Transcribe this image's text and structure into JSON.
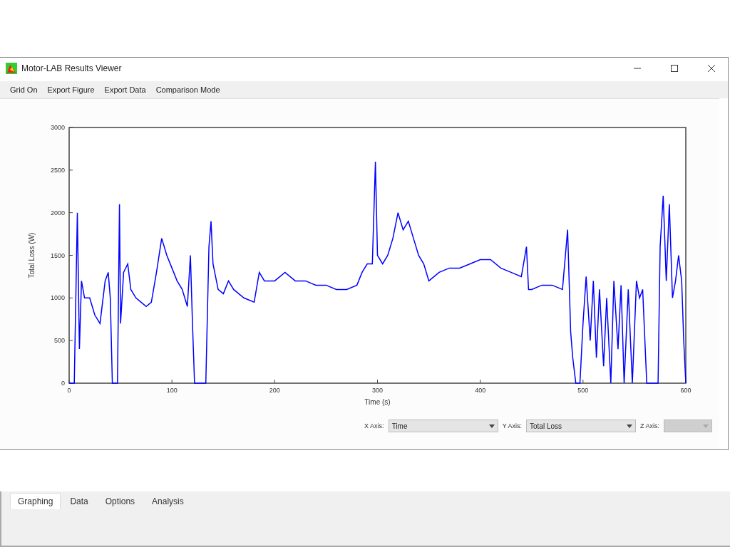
{
  "window": {
    "title": "Motor-LAB Results Viewer"
  },
  "menu": [
    "Grid On",
    "Export Figure",
    "Export Data",
    "Comparison Mode"
  ],
  "chart_data": {
    "type": "line",
    "xlabel": "Time (s)",
    "ylabel": "Total Loss (W)",
    "xlim": [
      0,
      600
    ],
    "ylim": [
      0,
      3000
    ],
    "xticks": [
      0,
      100,
      200,
      300,
      400,
      500,
      600
    ],
    "yticks": [
      0,
      500,
      1000,
      1500,
      2000,
      2500,
      3000
    ],
    "x": [
      0,
      5,
      8,
      10,
      12,
      15,
      20,
      25,
      30,
      35,
      38,
      40,
      42,
      47,
      49,
      50,
      53,
      57,
      60,
      65,
      70,
      75,
      80,
      85,
      90,
      95,
      100,
      105,
      110,
      115,
      118,
      120,
      122,
      133,
      136,
      138,
      140,
      145,
      150,
      155,
      160,
      170,
      180,
      185,
      190,
      200,
      210,
      220,
      230,
      240,
      250,
      260,
      270,
      280,
      285,
      290,
      295,
      298,
      300,
      305,
      310,
      315,
      320,
      325,
      330,
      335,
      340,
      345,
      350,
      355,
      360,
      370,
      380,
      390,
      400,
      410,
      420,
      430,
      440,
      445,
      447,
      450,
      460,
      470,
      480,
      485,
      488,
      490,
      493,
      497,
      500,
      503,
      507,
      510,
      513,
      516,
      520,
      523,
      527,
      530,
      534,
      537,
      540,
      544,
      548,
      552,
      555,
      558,
      562,
      573,
      575,
      578,
      581,
      584,
      587,
      590,
      593,
      596,
      598,
      600
    ],
    "series": [
      {
        "color": "#0000ff",
        "values": [
          0,
          0,
          2000,
          400,
          1200,
          1000,
          1000,
          800,
          700,
          1200,
          1300,
          1000,
          0,
          0,
          2100,
          700,
          1300,
          1400,
          1100,
          1000,
          950,
          900,
          950,
          1300,
          1700,
          1500,
          1350,
          1200,
          1100,
          900,
          1500,
          700,
          0,
          0,
          1600,
          1900,
          1400,
          1100,
          1050,
          1200,
          1100,
          1000,
          950,
          1300,
          1200,
          1200,
          1300,
          1200,
          1200,
          1150,
          1150,
          1100,
          1100,
          1150,
          1300,
          1400,
          1400,
          2600,
          1500,
          1400,
          1500,
          1700,
          2000,
          1800,
          1900,
          1700,
          1500,
          1400,
          1200,
          1250,
          1300,
          1350,
          1350,
          1400,
          1450,
          1450,
          1350,
          1300,
          1250,
          1600,
          1100,
          1100,
          1150,
          1150,
          1100,
          1800,
          600,
          300,
          0,
          0,
          700,
          1250,
          500,
          1200,
          300,
          1100,
          200,
          1000,
          0,
          1200,
          400,
          1150,
          0,
          1100,
          0,
          1200,
          1000,
          1100,
          0,
          0,
          1600,
          2200,
          1200,
          2100,
          1000,
          1200,
          1500,
          1200,
          500,
          0
        ]
      }
    ]
  },
  "axis_selectors": [
    {
      "label": "X Axis:",
      "value": "Time",
      "disabled": false
    },
    {
      "label": "Y Axis:",
      "value": "Total Loss",
      "disabled": false
    },
    {
      "label": "Z Axis:",
      "disabled": true
    }
  ],
  "tabs": [
    {
      "label": "Graphing",
      "selected": true
    },
    {
      "label": "Data",
      "selected": false
    },
    {
      "label": "Options",
      "selected": false
    },
    {
      "label": "Analysis",
      "selected": false
    }
  ]
}
